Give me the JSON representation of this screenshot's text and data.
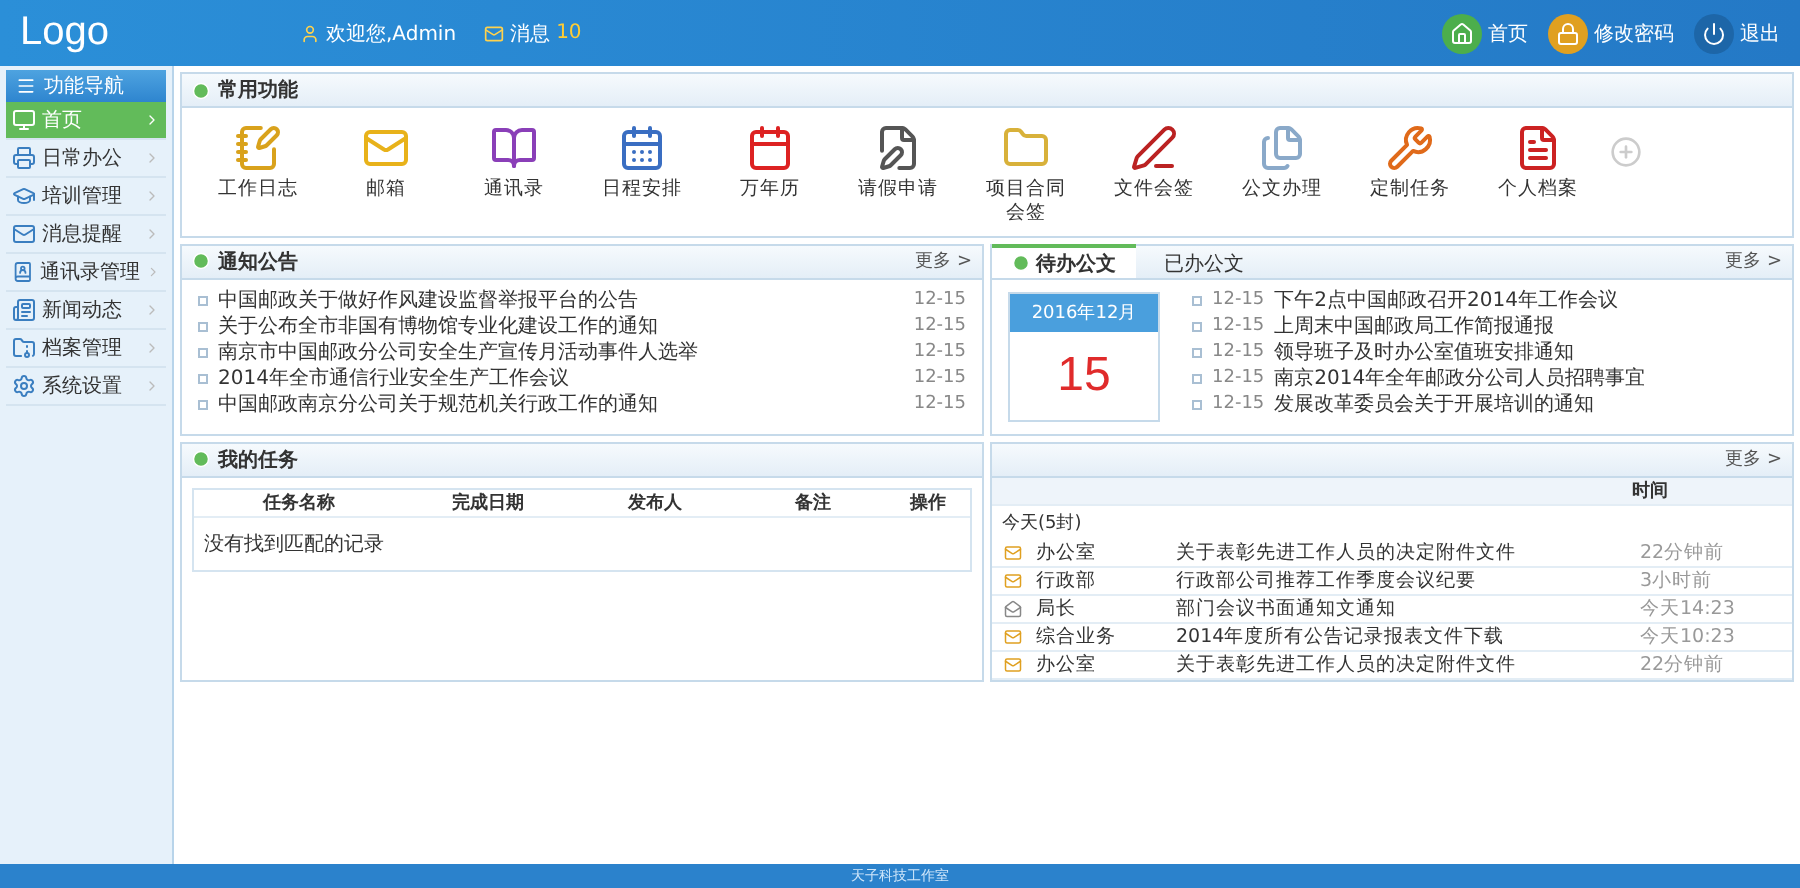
{
  "header": {
    "logo": "Logo",
    "welcome": "欢迎您,Admin",
    "messages_label": "消息",
    "messages_count": "10",
    "actions": [
      "首页",
      "修改密码",
      "退出"
    ]
  },
  "sidebar": {
    "title": "功能导航",
    "items": [
      {
        "label": "首页",
        "selected": true
      },
      {
        "label": "日常办公",
        "selected": false
      },
      {
        "label": "培训管理",
        "selected": false
      },
      {
        "label": "消息提醒",
        "selected": false
      },
      {
        "label": "通讯录管理",
        "selected": false
      },
      {
        "label": "新闻动态",
        "selected": false
      },
      {
        "label": "档案管理",
        "selected": false
      },
      {
        "label": "系统设置",
        "selected": false
      }
    ]
  },
  "functions": {
    "title": "常用功能",
    "items": [
      "工作日志",
      "邮箱",
      "通讯录",
      "日程安排",
      "万年历",
      "请假申请",
      "项目合同会签",
      "文件会签",
      "公文办理",
      "定制任务",
      "个人档案"
    ]
  },
  "notices": {
    "title": "通知公告",
    "more": "更多 >",
    "items": [
      {
        "text": "中国邮政关于做好作风建设监督举报平台的公告",
        "date": "12-15"
      },
      {
        "text": "关于公布全市非国有博物馆专业化建设工作的通知",
        "date": "12-15"
      },
      {
        "text": "南京市中国邮政分公司安全生产宣传月活动事件人选举",
        "date": "12-15"
      },
      {
        "text": "2014年全市通信行业安全生产工作会议",
        "date": "12-15"
      },
      {
        "text": "中国邮政南京分公司关于规范机关行政工作的通知",
        "date": "12-15"
      }
    ]
  },
  "documents": {
    "tabs": [
      {
        "label": "待办公文",
        "selected": true
      },
      {
        "label": "已办公文",
        "selected": false
      }
    ],
    "more": "更多 >",
    "calendar": {
      "month": "2016年12月",
      "day": "15"
    },
    "items": [
      {
        "date": "12-15",
        "text": "下午2点中国邮政召开2014年工作会议"
      },
      {
        "date": "12-15",
        "text": "上周末中国邮政局工作简报通报"
      },
      {
        "date": "12-15",
        "text": "领导班子及时办公室值班安排通知"
      },
      {
        "date": "12-15",
        "text": "南京2014年全年邮政分公司人员招聘事宜"
      },
      {
        "date": "12-15",
        "text": "发展改革委员会关于开展培训的通知"
      }
    ]
  },
  "tasks": {
    "title": "我的任务",
    "columns": [
      "任务名称",
      "完成日期",
      "发布人",
      "备注",
      "操作"
    ],
    "empty": "没有找到匹配的记录"
  },
  "mail": {
    "more": "更多 >",
    "time_column": "时间",
    "group": "今天(5封)",
    "rows": [
      {
        "read": false,
        "sender": "办公室",
        "subject": "关于表彰先进工作人员的决定附件文件",
        "time": "22分钟前"
      },
      {
        "read": false,
        "sender": "行政部",
        "subject": "行政部公司推荐工作季度会议纪要",
        "time": "3小时前"
      },
      {
        "read": true,
        "sender": "局长",
        "subject": "部门会议书面通知文通知",
        "time": "今天14:23"
      },
      {
        "read": false,
        "sender": "综合业务",
        "subject": "2014年度所有公告记录报表文件下载",
        "time": "今天10:23"
      },
      {
        "read": false,
        "sender": "办公室",
        "subject": "关于表彰先进工作人员的决定附件文件",
        "time": "22分钟前"
      }
    ]
  },
  "footer": "天子科技工作室"
}
